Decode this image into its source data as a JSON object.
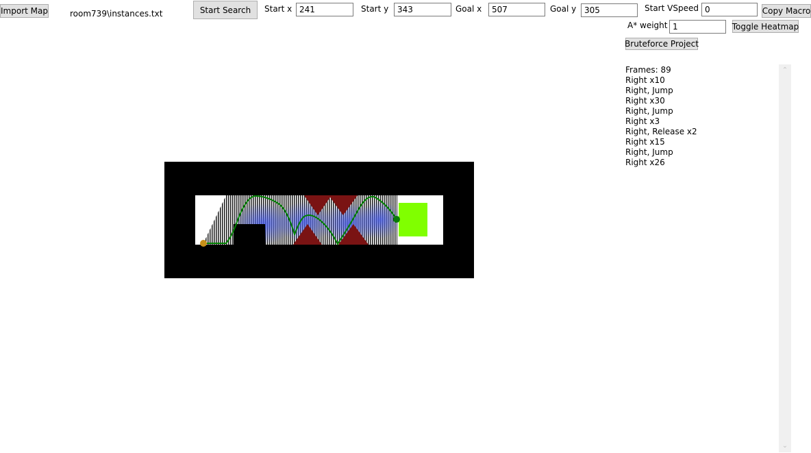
{
  "toolbar": {
    "import_map_label": "Import Map",
    "file_path": "room739\\instances.txt",
    "start_search_label": "Start Search",
    "start_x_label": "Start x",
    "start_x_value": "241",
    "start_y_label": "Start y",
    "start_y_value": "343",
    "goal_x_label": "Goal x",
    "goal_x_value": "507",
    "goal_y_label": "Goal y",
    "goal_y_value": "305",
    "start_vspeed_label": "Start VSpeed",
    "start_vspeed_value": "0",
    "copy_macro_label": "Copy Macro",
    "astar_weight_label": "A* weight",
    "astar_weight_value": "1",
    "toggle_heatmap_label": "Toggle Heatmap",
    "bruteforce_label": "Bruteforce Project"
  },
  "output": {
    "lines": [
      "Frames: 89",
      "Right x10",
      "Right, Jump",
      "Right x30",
      "Right, Jump",
      "Right x3",
      "Right, Release x2",
      "Right x15",
      "Right, Jump",
      "Right x26"
    ]
  },
  "map": {
    "colors": {
      "wall": "#000000",
      "floor": "#ffffff",
      "spike": "#7a1313",
      "goal": "#80ff00",
      "path": "#008000",
      "start_marker": "#c8901a",
      "heat": "#4a5ee6"
    }
  }
}
